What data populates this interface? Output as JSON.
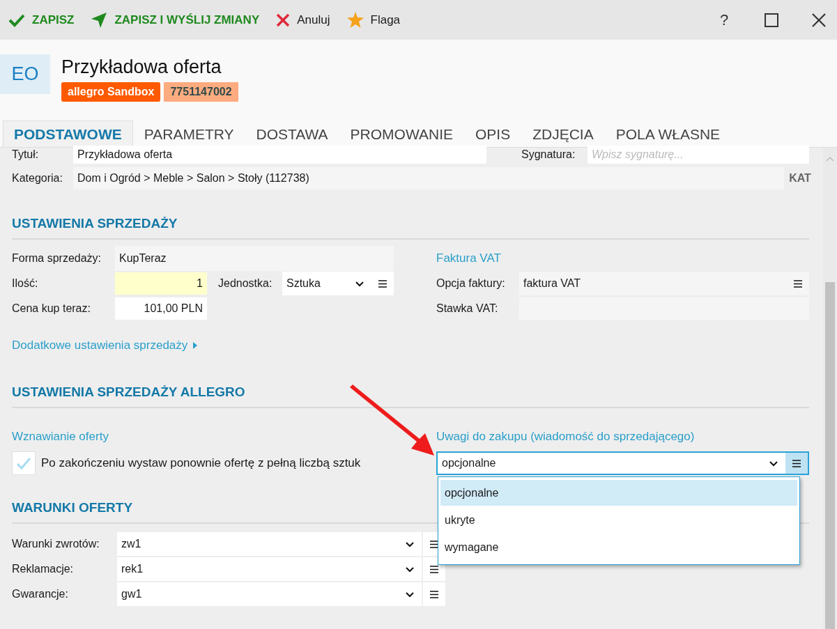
{
  "toolbar": {
    "actions": [
      {
        "label": "ZAPISZ",
        "kind": "save"
      },
      {
        "label": "ZAPISZ I WYŚLIJ ZMIANY",
        "kind": "send"
      },
      {
        "label": "Anuluj",
        "kind": "cancel"
      },
      {
        "label": "Flaga",
        "kind": "flag"
      }
    ],
    "window_controls": [
      {
        "kind": "help",
        "label": "?"
      },
      {
        "kind": "maximize"
      },
      {
        "kind": "close"
      }
    ]
  },
  "header": {
    "initials": "EO",
    "title": "Przykładowa oferta",
    "badges": [
      {
        "label": "allegro Sandbox",
        "kind": "platform",
        "color": "#ff5a00"
      },
      {
        "label": "7751147002",
        "kind": "id",
        "color": "#ffab80"
      }
    ]
  },
  "tabs": [
    {
      "label": "PODSTAWOWE",
      "selected": true
    },
    {
      "label": "PARAMETRY",
      "selected": false
    },
    {
      "label": "DOSTAWA",
      "selected": false
    },
    {
      "label": "PROMOWANIE",
      "selected": false
    },
    {
      "label": "OPIS",
      "selected": false
    },
    {
      "label": "ZDJĘCIA",
      "selected": false
    },
    {
      "label": "POLA WŁASNE",
      "selected": false
    }
  ],
  "top_fields": {
    "title": {
      "label": "Tytuł:",
      "value": "Przykładowa oferta"
    },
    "signature": {
      "label": "Sygnatura:",
      "placeholder": "Wpisz sygnaturę..."
    },
    "category": {
      "label": "Kategoria:",
      "value": "Dom i Ogród > Meble > Salon > Stoły (112738)",
      "button": "KAT"
    }
  },
  "sales_settings": {
    "heading": "USTAWIENIA SPRZEDAŻY",
    "sale_form": {
      "label": "Forma sprzedaży:",
      "value": "KupTeraz"
    },
    "quantity": {
      "label": "Ilość:",
      "value": "1"
    },
    "unit": {
      "label": "Jednostka:",
      "value": "Sztuka"
    },
    "price": {
      "label": "Cena kup teraz:",
      "value": "101,00 PLN"
    },
    "invoice": {
      "heading": "Faktura VAT",
      "option": {
        "label": "Opcja faktury:",
        "value": "faktura VAT"
      },
      "rate": {
        "label": "Stawka VAT:"
      }
    },
    "more_link": "Dodatkowe ustawienia sprzedaży"
  },
  "allegro_settings": {
    "heading": "USTAWIENIA SPRZEDAŻY ALLEGRO",
    "renewal": {
      "heading": "Wznawianie oferty",
      "label": "Po zakończeniu wystaw ponownie ofertę z pełną liczbą sztuk",
      "checked": true
    },
    "remarks": {
      "heading": "Uwagi do zakupu (wiadomość do sprzedającego)",
      "value": "opcjonalne",
      "expanded": true,
      "options": [
        {
          "label": "opcjonalne",
          "selected": true
        },
        {
          "label": "ukryte",
          "selected": false
        },
        {
          "label": "wymagane",
          "selected": false
        }
      ]
    }
  },
  "offer_terms": {
    "heading": "WARUNKI OFERTY",
    "rows": [
      {
        "label": "Warunki zwrotów:",
        "value": "zw1"
      },
      {
        "label": "Reklamacje:",
        "value": "rek1"
      },
      {
        "label": "Gwarancje:",
        "value": "gw1"
      }
    ]
  }
}
